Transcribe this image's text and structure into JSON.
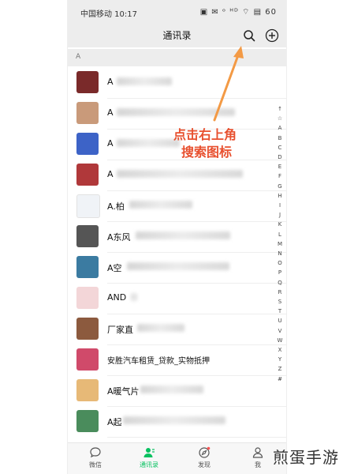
{
  "status_bar": {
    "carrier_time": "中国移动 10:17",
    "indicators": "▣ ✉ ᵒ ᴴᴰ ⌔ ▤ 60"
  },
  "nav": {
    "title": "通讯录",
    "search_icon": "search-icon",
    "add_icon": "plus-circle-icon"
  },
  "section_header": "A",
  "contacts": [
    {
      "name": "A",
      "color": "#7a2a2a"
    },
    {
      "name": "A",
      "color": "#c99a7a"
    },
    {
      "name": "A",
      "color": "#3d63c7"
    },
    {
      "name": "A",
      "color": "#b0383a"
    },
    {
      "name": "A.柏",
      "color": "#f0f3f7"
    },
    {
      "name": "A东风",
      "color": "#555555"
    },
    {
      "name": "A空",
      "color": "#3b7ba1"
    },
    {
      "name": "AND",
      "color": "#f3d6d8"
    },
    {
      "name": "厂家直",
      "color": "#8c5a3e"
    },
    {
      "name": "安胜汽车租赁_贷款_实物抵押",
      "color": "#d04a6a"
    },
    {
      "name": "A暖气片",
      "color": "#e7b977"
    },
    {
      "name": "A起",
      "color": "#4a8c5c"
    }
  ],
  "index_letters": [
    "↑",
    "☆",
    "A",
    "B",
    "C",
    "D",
    "E",
    "F",
    "G",
    "H",
    "I",
    "J",
    "K",
    "L",
    "M",
    "N",
    "O",
    "P",
    "Q",
    "R",
    "S",
    "T",
    "U",
    "V",
    "W",
    "X",
    "Y",
    "Z",
    "#"
  ],
  "annotation": {
    "line1": "点击右上角",
    "line2": "搜索图标",
    "color": "#e8502f"
  },
  "tabs": [
    {
      "label": "微信",
      "icon": "chat-bubble-icon"
    },
    {
      "label": "通讯录",
      "icon": "contacts-icon",
      "active": true
    },
    {
      "label": "发现",
      "icon": "compass-icon"
    },
    {
      "label": "我",
      "icon": "person-icon"
    }
  ],
  "watermark": "煎蛋手游"
}
